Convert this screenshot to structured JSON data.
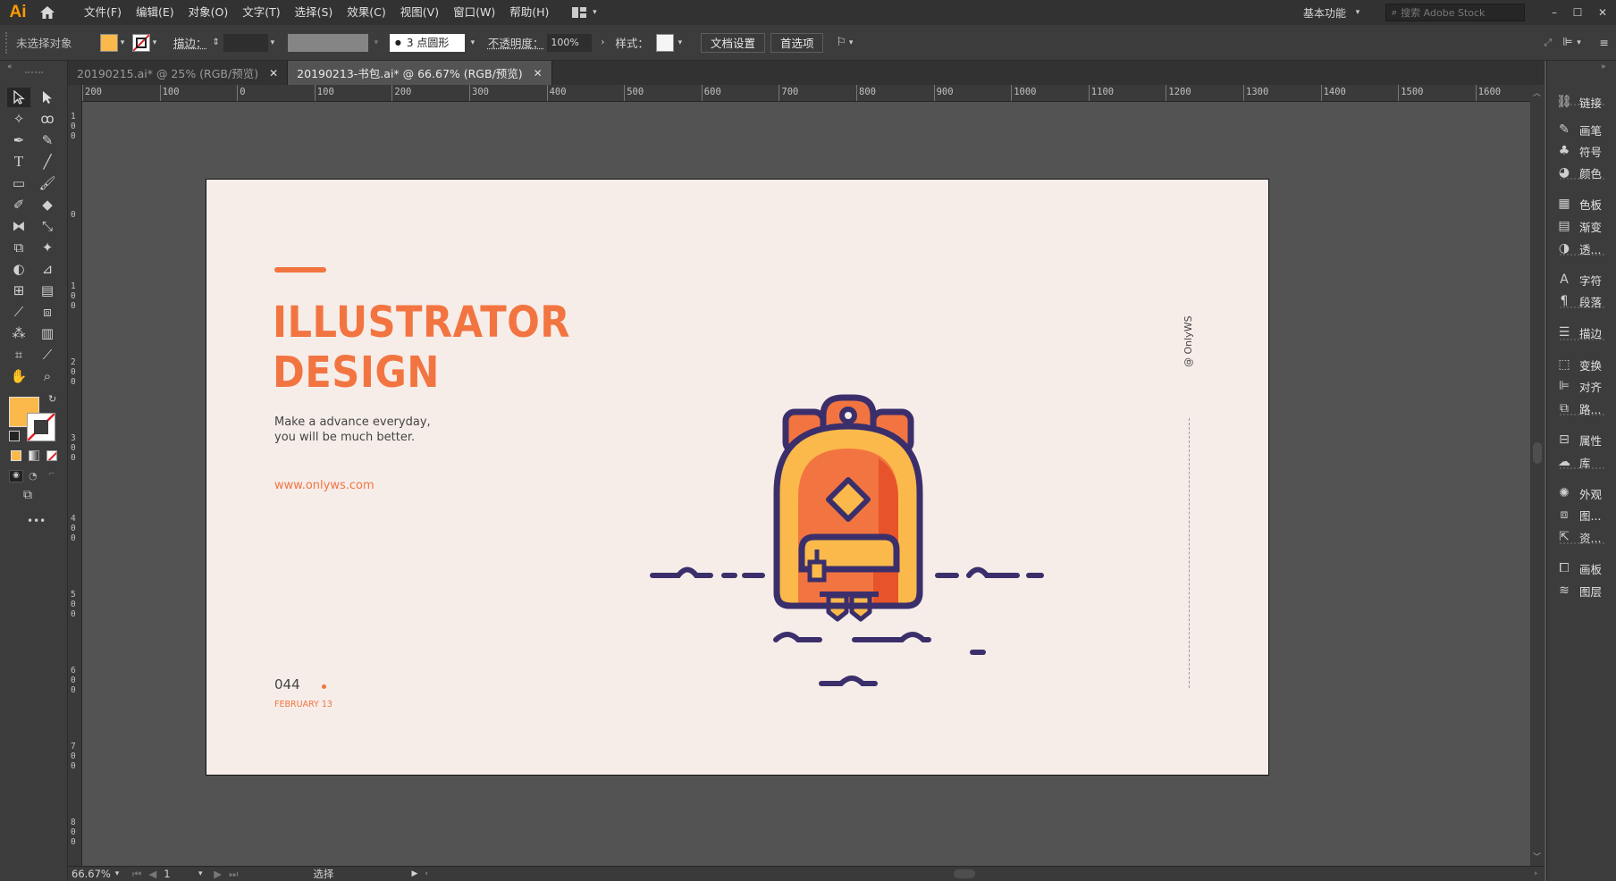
{
  "app": {
    "logo": "Ai",
    "home_icon": "home-icon"
  },
  "menu": [
    "文件(F)",
    "编辑(E)",
    "对象(O)",
    "文字(T)",
    "选择(S)",
    "效果(C)",
    "视图(V)",
    "窗口(W)",
    "帮助(H)"
  ],
  "workspace": {
    "label": "基本功能",
    "search_placeholder": "搜索 Adobe Stock"
  },
  "control": {
    "selection_label": "未选择对象",
    "fill_color": "#fbb94b",
    "stroke_label": "描边：",
    "brush_value": "3 点圆形",
    "opacity_label": "不透明度：",
    "opacity_value": "100%",
    "style_label": "样式：",
    "doc_setup": "文档设置",
    "prefs": "首选项"
  },
  "tabs": [
    {
      "label": "20190215.ai* @ 25% (RGB/预览)",
      "active": false
    },
    {
      "label": "20190213-书包.ai* @ 66.67% (RGB/预览)",
      "active": true
    }
  ],
  "hruler_ticks": [
    "200",
    "100",
    "0",
    "100",
    "200",
    "300",
    "400",
    "500",
    "600",
    "700",
    "800",
    "900",
    "1000",
    "1100",
    "1200",
    "1300",
    "1400",
    "1500",
    "1600"
  ],
  "vruler_ticks": [
    "1 0 0",
    "0",
    "1 0 0",
    "2 0 0",
    "3 0 0",
    "4 0 0",
    "5 0 0",
    "6 0 0",
    "7 0 0",
    "8 0 0"
  ],
  "artboard": {
    "title_line1": "ILLUSTRATOR",
    "title_line2": "DESIGN",
    "tagline1": "Make a advance everyday,",
    "tagline2": "you will be much better.",
    "url": "www.onlyws.com",
    "number": "044",
    "date": "FEBRUARY 13",
    "signature": "@ OnlyWS",
    "accent": "#f27541",
    "navy": "#3b2f6b"
  },
  "panels": [
    {
      "label": "链接",
      "icon": "link-icon"
    },
    {
      "label": "画笔",
      "icon": "brush-icon"
    },
    {
      "label": "符号",
      "icon": "club-icon"
    },
    {
      "label": "颜色",
      "icon": "palette-icon"
    },
    {
      "label": "色板",
      "icon": "grid-icon"
    },
    {
      "label": "渐变",
      "icon": "gradient-icon"
    },
    {
      "label": "透...",
      "icon": "transparency-icon"
    },
    {
      "label": "字符",
      "icon": "character-icon"
    },
    {
      "label": "段落",
      "icon": "pilcrow-icon"
    },
    {
      "label": "描边",
      "icon": "stroke-icon"
    },
    {
      "label": "变换",
      "icon": "transform-icon"
    },
    {
      "label": "对齐",
      "icon": "align-icon"
    },
    {
      "label": "路...",
      "icon": "pathfinder-icon"
    },
    {
      "label": "属性",
      "icon": "properties-icon"
    },
    {
      "label": "库",
      "icon": "library-icon"
    },
    {
      "label": "外观",
      "icon": "appearance-icon"
    },
    {
      "label": "图...",
      "icon": "graphic-style-icon"
    },
    {
      "label": "资...",
      "icon": "asset-export-icon"
    },
    {
      "label": "画板",
      "icon": "artboards-icon"
    },
    {
      "label": "图层",
      "icon": "layers-icon"
    }
  ],
  "status": {
    "zoom": "66.67%",
    "artboard_num": "1",
    "tool": "选择"
  }
}
